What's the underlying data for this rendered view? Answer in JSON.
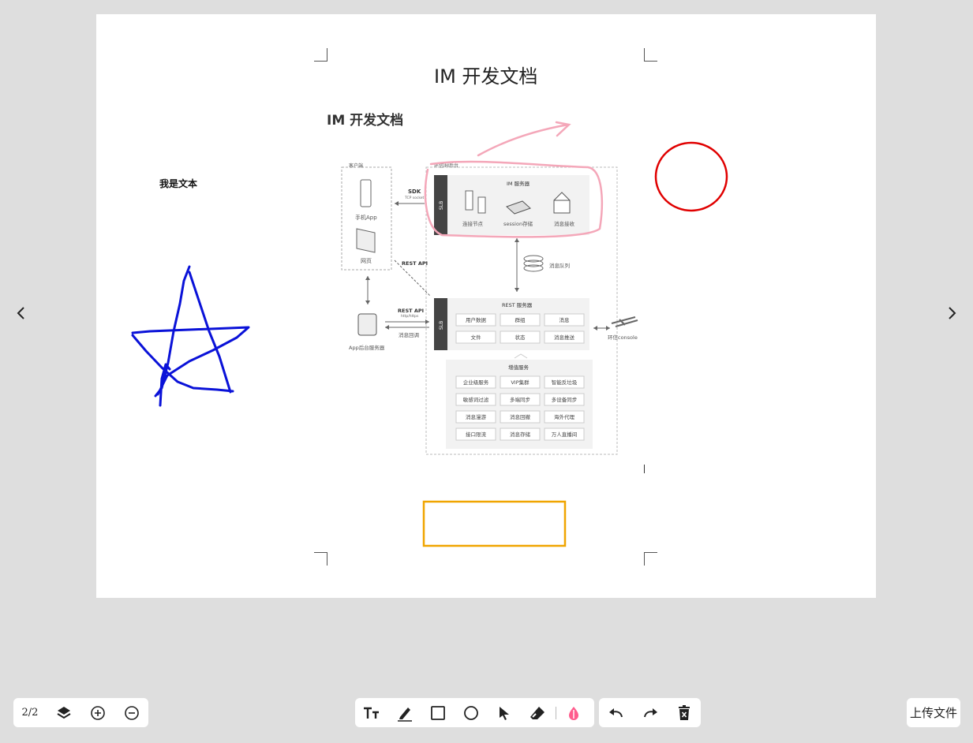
{
  "slide": {
    "title": "IM 开发文档",
    "heading": "IM 开发文档",
    "text_note": "我是文本"
  },
  "diagram": {
    "client_group": "客户端",
    "mobile_app": "手机App",
    "web": "网页",
    "sdk": "SDK",
    "tcp": "TCP socket",
    "rest_api_1": "REST API",
    "rest_api_2": "REST API",
    "http": "http/https",
    "callback": "消息回调",
    "app_server": "App后台服务器",
    "cloud_group": "环信IM后台",
    "slb": "SLB",
    "im_server": "IM 服务器",
    "conn_node": "连接节点",
    "session_store": "session存储",
    "msg_recv": "消息接收",
    "msg_queue": "消息队列",
    "rest_server": "REST 服务器",
    "rest_items": [
      "用户数据",
      "群组",
      "消息",
      "文件",
      "状态",
      "消息推送"
    ],
    "console": "环信console",
    "value_added": "增值服务",
    "va_items": [
      "企业级服务",
      "VIP集群",
      "智能反垃圾",
      "敏感词过滤",
      "多端同步",
      "多设备同步",
      "消息漫游",
      "消息回撤",
      "海外代理",
      "接口限流",
      "消息存储",
      "万人直播间"
    ]
  },
  "toolbar": {
    "page_indicator": "2/2",
    "upload_label": "上传文件"
  },
  "icons": {
    "prev": "chevron-left-icon",
    "next": "chevron-right-icon",
    "layers": "layers-icon",
    "zoom_in": "zoom-in-icon",
    "zoom_out": "zoom-out-icon",
    "text": "text-tool-icon",
    "pen": "pen-icon",
    "rectangle": "rectangle-icon",
    "circle": "circle-icon",
    "select": "pointer-icon",
    "eraser": "eraser-icon",
    "color": "color-icon",
    "undo": "undo-icon",
    "redo": "redo-icon",
    "delete": "trash-icon"
  },
  "colors": {
    "background": "#dedede",
    "canvas": "#ffffff",
    "star_stroke": "#0a12d8",
    "circle_stroke": "#e00000",
    "rect_stroke": "#f0a500",
    "highlight_stroke": "#f4a7b9",
    "color_tool": "#ff5c8d"
  }
}
